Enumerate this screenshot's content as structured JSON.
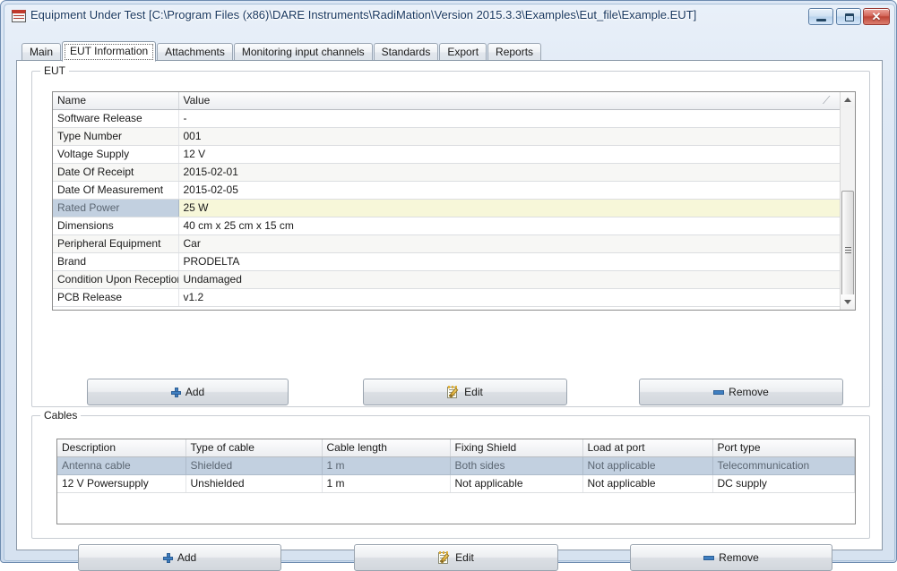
{
  "window": {
    "title": "Equipment Under Test [C:\\Program Files (x86)\\DARE Instruments\\RadiMation\\Version 2015.3.3\\Examples\\Eut_file\\Example.EUT]",
    "app_icon": "application-icon",
    "controls": {
      "minimize": "minimize-icon",
      "maximize": "maximize-icon",
      "close": "✕"
    }
  },
  "tabs": [
    {
      "label": "Main",
      "active": false
    },
    {
      "label": "EUT Information",
      "active": true
    },
    {
      "label": "Attachments",
      "active": false
    },
    {
      "label": "Monitoring input channels",
      "active": false
    },
    {
      "label": "Standards",
      "active": false
    },
    {
      "label": "Export",
      "active": false
    },
    {
      "label": "Reports",
      "active": false
    }
  ],
  "eut_group": {
    "title": "EUT",
    "columns": [
      "Name",
      "Value"
    ],
    "rows": [
      {
        "name": "Software Release",
        "value": "-",
        "selected": false
      },
      {
        "name": "Type Number",
        "value": "001",
        "selected": false
      },
      {
        "name": "Voltage Supply",
        "value": "12 V",
        "selected": false
      },
      {
        "name": "Date Of Receipt",
        "value": "2015-02-01",
        "selected": false
      },
      {
        "name": "Date Of Measurement",
        "value": "2015-02-05",
        "selected": false
      },
      {
        "name": "Rated Power",
        "value": "25 W",
        "selected": true
      },
      {
        "name": "Dimensions",
        "value": "40 cm x 25 cm x 15 cm",
        "selected": false
      },
      {
        "name": "Peripheral Equipment",
        "value": "Car",
        "selected": false
      },
      {
        "name": "Brand",
        "value": "PRODELTA",
        "selected": false
      },
      {
        "name": "Condition Upon Reception",
        "value": "Undamaged",
        "selected": false
      },
      {
        "name": "PCB Release",
        "value": "v1.2",
        "selected": false
      }
    ],
    "buttons": {
      "add": "Add",
      "edit": "Edit",
      "remove": "Remove"
    }
  },
  "cables_group": {
    "title": "Cables",
    "columns": [
      "Description",
      "Type of cable",
      "Cable length",
      "Fixing Shield",
      "Load at port",
      "Port type"
    ],
    "rows": [
      {
        "description": "Antenna cable",
        "type_of_cable": "Shielded",
        "cable_length": "1 m",
        "fixing_shield": "Both sides",
        "load_at_port": "Not applicable",
        "port_type": "Telecommunication",
        "selected": true
      },
      {
        "description": "12 V Powersupply",
        "type_of_cable": "Unshielded",
        "cable_length": "1 m",
        "fixing_shield": "Not applicable",
        "load_at_port": "Not applicable",
        "port_type": "DC supply",
        "selected": false
      }
    ],
    "buttons": {
      "add": "Add",
      "edit": "Edit",
      "remove": "Remove"
    }
  },
  "colors": {
    "selection": "#c2d0e0",
    "highlight_value": "#f7f7d9",
    "close_button": "#bd4436",
    "icon_blue": "#3f7fc1",
    "titlebar": "#d3e0f0"
  }
}
